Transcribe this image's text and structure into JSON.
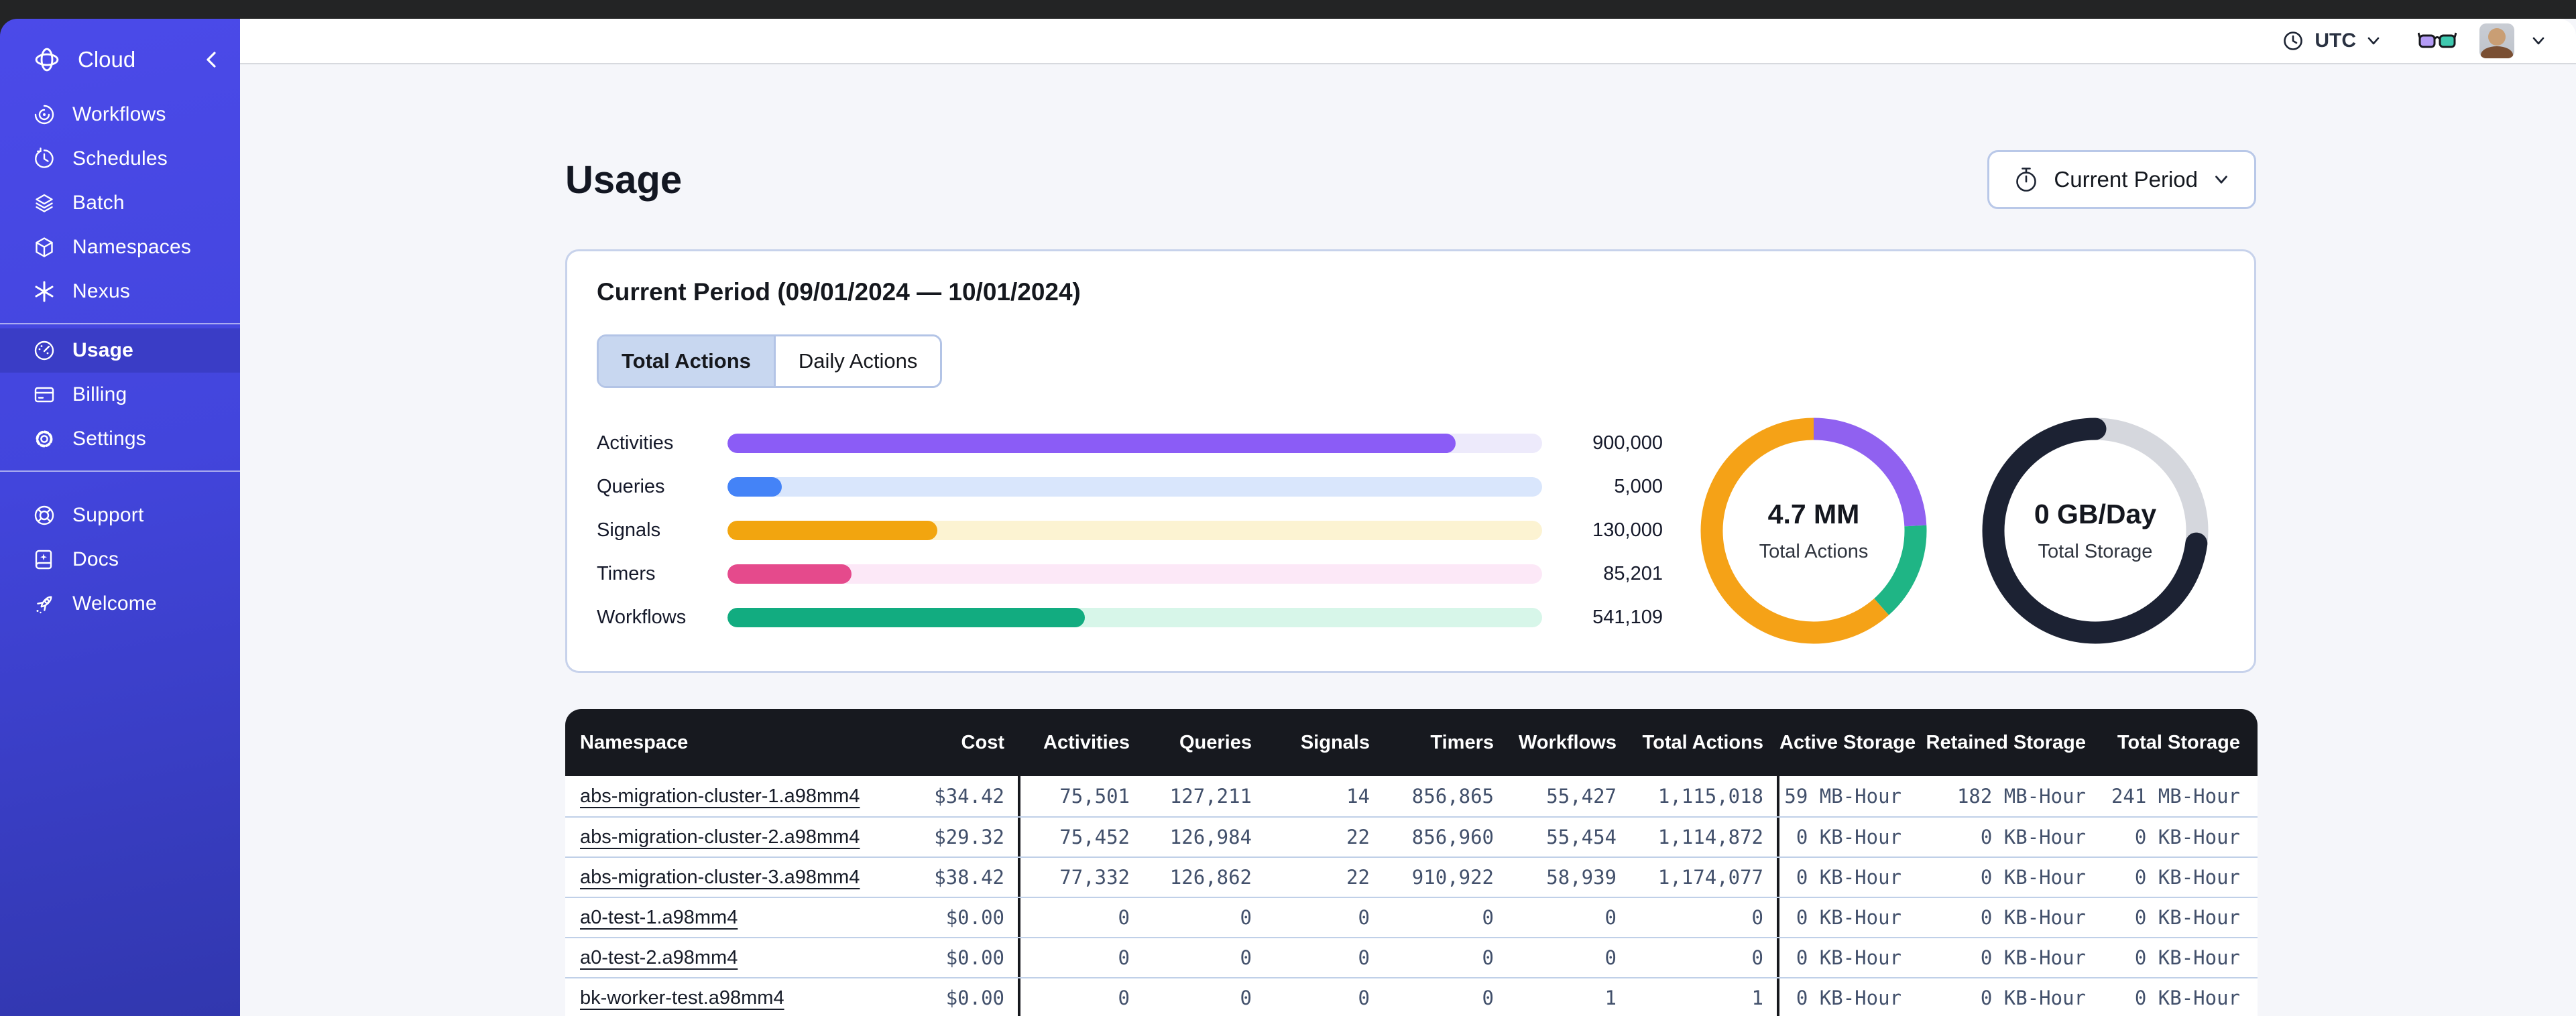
{
  "sidebar": {
    "brand": "Cloud",
    "groups": [
      {
        "items": [
          {
            "label": "Workflows"
          },
          {
            "label": "Schedules"
          },
          {
            "label": "Batch"
          },
          {
            "label": "Namespaces"
          },
          {
            "label": "Nexus"
          }
        ]
      },
      {
        "items": [
          {
            "label": "Usage",
            "active": true
          },
          {
            "label": "Billing"
          },
          {
            "label": "Settings"
          }
        ]
      },
      {
        "items": [
          {
            "label": "Support"
          },
          {
            "label": "Docs"
          },
          {
            "label": "Welcome"
          }
        ]
      }
    ]
  },
  "topbar": {
    "timezone": "UTC"
  },
  "page": {
    "title": "Usage",
    "period_button_label": "Current Period"
  },
  "card": {
    "title": "Current Period (09/01/2024 — 10/01/2024)",
    "tabs": [
      {
        "label": "Total Actions",
        "selected": true
      },
      {
        "label": "Daily Actions",
        "selected": false
      }
    ]
  },
  "chart_data": [
    {
      "type": "bar",
      "orientation": "horizontal",
      "categories": [
        "Activities",
        "Queries",
        "Signals",
        "Timers",
        "Workflows"
      ],
      "values": [
        900000,
        5000,
        130000,
        85201,
        541109
      ],
      "display_values": [
        "900,000",
        "5,000",
        "130,000",
        "85,201",
        "541,109"
      ],
      "fill_percents": [
        89.4,
        6.7,
        25.8,
        15.2,
        43.9
      ],
      "colors": [
        "#8B5CF6",
        "#4483F7",
        "#F2A50F",
        "#E54A8C",
        "#12AC80"
      ],
      "track_colors": [
        "#EDEAFB",
        "#D9E6FC",
        "#FCF3D2",
        "#FCE8F7",
        "#D7F6E9"
      ],
      "title": "",
      "xlabel": "",
      "ylabel": "",
      "grid": false,
      "legend": "none"
    },
    {
      "type": "pie",
      "title": "Total Actions donut",
      "center_value": "4.7 MM",
      "center_label": "Total Actions",
      "linecap": "butt",
      "segments": [
        {
          "name": "purple",
          "value": 24.2,
          "color": "#9061F0"
        },
        {
          "name": "green",
          "value": 14.2,
          "color": "#1FB585"
        },
        {
          "name": "orange",
          "value": 61.6,
          "color": "#F5A217"
        }
      ]
    },
    {
      "type": "pie",
      "title": "Total Storage donut",
      "center_value": "0 GB/Day",
      "center_label": "Total Storage",
      "linecap": "round",
      "background_color": "#D5D7DD",
      "segments": [
        {
          "name": "remaining",
          "value": 27.0,
          "color": "#D5D7DD"
        },
        {
          "name": "used",
          "value": 73.0,
          "color": "#1C2233"
        }
      ]
    }
  ],
  "table": {
    "columns": [
      "Namespace",
      "Cost",
      "Activities",
      "Queries",
      "Signals",
      "Timers",
      "Workflows",
      "Total Actions",
      "Active Storage",
      "Retained Storage",
      "Total Storage"
    ],
    "rows": [
      {
        "namespace": "abs-migration-cluster-1.a98mm4",
        "values": [
          "$34.42",
          "75,501",
          "127,211",
          "14",
          "856,865",
          "55,427",
          "1,115,018",
          "59 MB-Hour",
          "182 MB-Hour",
          "241 MB-Hour"
        ]
      },
      {
        "namespace": "abs-migration-cluster-2.a98mm4",
        "values": [
          "$29.32",
          "75,452",
          "126,984",
          "22",
          "856,960",
          "55,454",
          "1,114,872",
          "0 KB-Hour",
          "0 KB-Hour",
          "0 KB-Hour"
        ]
      },
      {
        "namespace": "abs-migration-cluster-3.a98mm4",
        "values": [
          "$38.42",
          "77,332",
          "126,862",
          "22",
          "910,922",
          "58,939",
          "1,174,077",
          "0 KB-Hour",
          "0 KB-Hour",
          "0 KB-Hour"
        ]
      },
      {
        "namespace": "a0-test-1.a98mm4",
        "values": [
          "$0.00",
          "0",
          "0",
          "0",
          "0",
          "0",
          "0",
          "0 KB-Hour",
          "0 KB-Hour",
          "0 KB-Hour"
        ]
      },
      {
        "namespace": "a0-test-2.a98mm4",
        "values": [
          "$0.00",
          "0",
          "0",
          "0",
          "0",
          "0",
          "0",
          "0 KB-Hour",
          "0 KB-Hour",
          "0 KB-Hour"
        ]
      },
      {
        "namespace": "bk-worker-test.a98mm4",
        "values": [
          "$0.00",
          "0",
          "0",
          "0",
          "0",
          "1",
          "1",
          "0 KB-Hour",
          "0 KB-Hour",
          "0 KB-Hour"
        ]
      }
    ]
  }
}
